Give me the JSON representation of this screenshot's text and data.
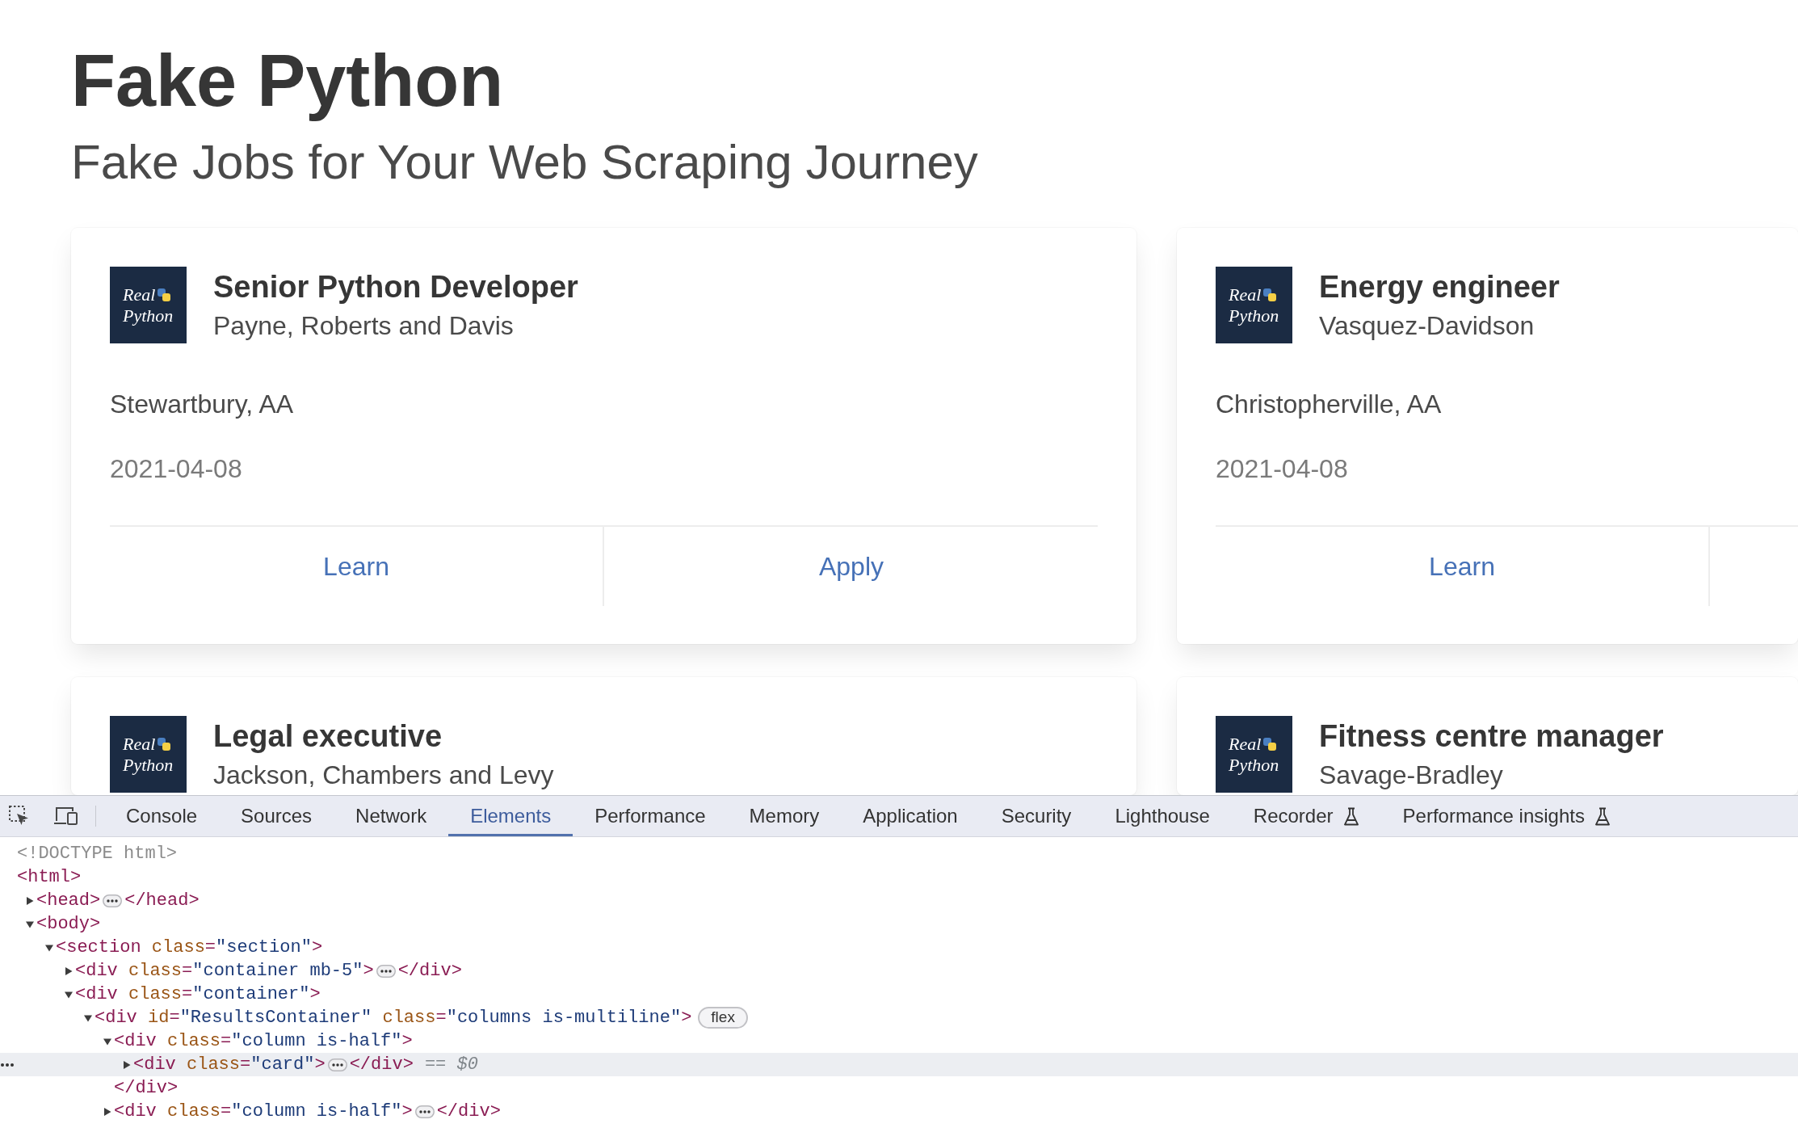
{
  "page": {
    "title": "Fake Python",
    "subtitle": "Fake Jobs for Your Web Scraping Journey"
  },
  "cards": [
    {
      "logo_lines": [
        "Real",
        "Python"
      ],
      "title": "Senior Python Developer",
      "company": "Payne, Roberts and Davis",
      "location": "Stewartbury, AA",
      "date": "2021-04-08",
      "links": [
        "Learn",
        "Apply"
      ]
    },
    {
      "logo_lines": [
        "Real",
        "Python"
      ],
      "title": "Energy engineer",
      "company": "Vasquez-Davidson",
      "location": "Christopherville, AA",
      "date": "2021-04-08",
      "links": [
        "Learn"
      ]
    },
    {
      "logo_lines": [
        "Real",
        "Python"
      ],
      "title": "Legal executive",
      "company": "Jackson, Chambers and Levy"
    },
    {
      "logo_lines": [
        "Real",
        "Python"
      ],
      "title": "Fitness centre manager",
      "company": "Savage-Bradley"
    }
  ],
  "devtools": {
    "tabs": [
      {
        "label": "Console",
        "selected": false,
        "experimental": false
      },
      {
        "label": "Sources",
        "selected": false,
        "experimental": false
      },
      {
        "label": "Network",
        "selected": false,
        "experimental": false
      },
      {
        "label": "Elements",
        "selected": true,
        "experimental": false
      },
      {
        "label": "Performance",
        "selected": false,
        "experimental": false
      },
      {
        "label": "Memory",
        "selected": false,
        "experimental": false
      },
      {
        "label": "Application",
        "selected": false,
        "experimental": false
      },
      {
        "label": "Security",
        "selected": false,
        "experimental": false
      },
      {
        "label": "Lighthouse",
        "selected": false,
        "experimental": false
      },
      {
        "label": "Recorder",
        "selected": false,
        "experimental": true
      },
      {
        "label": "Performance insights",
        "selected": false,
        "experimental": true
      }
    ],
    "dom_tree": [
      {
        "kind": "doctype",
        "text": "<!DOCTYPE html>",
        "selected": false
      },
      {
        "kind": "element",
        "open": "<html>",
        "selected": false,
        "children": [
          {
            "kind": "element",
            "open": "<head>",
            "close": "</head>",
            "expanded": false,
            "selected": false
          },
          {
            "kind": "element",
            "open": "<body>",
            "expanded": true,
            "selected": false,
            "children": [
              {
                "kind": "element",
                "open": "<section class=\"section\">",
                "expanded": true,
                "selected": false,
                "children": [
                  {
                    "kind": "element",
                    "open": "<div class=\"container mb-5\">",
                    "close": "</div>",
                    "expanded": false,
                    "selected": false
                  },
                  {
                    "kind": "element",
                    "open": "<div class=\"container\">",
                    "expanded": true,
                    "selected": false,
                    "children": [
                      {
                        "kind": "element",
                        "open": "<div id=\"ResultsContainer\" class=\"columns is-multiline\">",
                        "badge": "flex",
                        "expanded": true,
                        "selected": false,
                        "children": [
                          {
                            "kind": "element",
                            "open": "<div class=\"column is-half\">",
                            "close": "</div>",
                            "expanded": true,
                            "selected": false,
                            "children": [
                              {
                                "kind": "element",
                                "open": "<div class=\"card\">",
                                "close": "</div>",
                                "suffix": "== *$0*",
                                "expanded": false,
                                "selected": true
                              }
                            ]
                          },
                          {
                            "kind": "element",
                            "open": "<div class=\"column is-half\">",
                            "close": "</div>",
                            "expanded": false,
                            "selected": false
                          }
                        ]
                      }
                    ]
                  }
                ]
              }
            ]
          }
        ]
      }
    ]
  }
}
